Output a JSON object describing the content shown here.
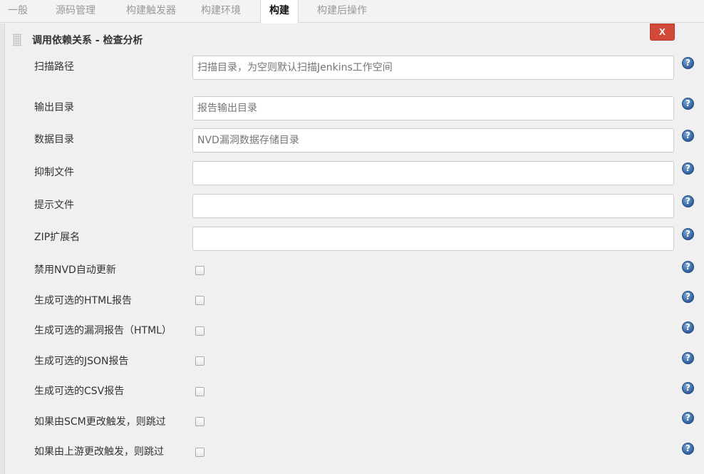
{
  "tabs": [
    {
      "label": "一般"
    },
    {
      "label": "源码管理"
    },
    {
      "label": "构建触发器"
    },
    {
      "label": "构建环境"
    },
    {
      "label": "构建"
    },
    {
      "label": "构建后操作"
    }
  ],
  "active_tab": "构建",
  "section": {
    "title": "调用依赖关系 - 检查分析",
    "delete_label": "X"
  },
  "fields": {
    "scan_path": {
      "label": "扫描路径",
      "placeholder": "扫描目录，为空则默认扫描Jenkins工作空间",
      "value": ""
    },
    "output_dir": {
      "label": "输出目录",
      "placeholder": "报告输出目录",
      "value": ""
    },
    "data_dir": {
      "label": "数据目录",
      "placeholder": "NVD漏洞数据存储目录",
      "value": ""
    },
    "suppression_file": {
      "label": "抑制文件",
      "placeholder": "",
      "value": ""
    },
    "hint_file": {
      "label": "提示文件",
      "placeholder": "",
      "value": ""
    },
    "zip_extensions": {
      "label": "ZIP扩展名",
      "placeholder": "",
      "value": ""
    }
  },
  "checkboxes": [
    {
      "label": "禁用NVD自动更新",
      "checked": false
    },
    {
      "label": "生成可选的HTML报告",
      "checked": false
    },
    {
      "label": "生成可选的漏洞报告（HTML）",
      "checked": false
    },
    {
      "label": "生成可选的JSON报告",
      "checked": false
    },
    {
      "label": "生成可选的CSV报告",
      "checked": false
    },
    {
      "label": "如果由SCM更改触发，则跳过",
      "checked": false
    },
    {
      "label": "如果由上游更改触发，则跳过",
      "checked": false
    }
  ],
  "help_glyph": "?",
  "icons": {
    "help": "help-icon",
    "grip": "drag-handle-icon",
    "delete": "close-icon"
  },
  "colors": {
    "delete_button": "#d24939",
    "help_icon": "#2f5f9e",
    "background": "#f0f0f0"
  }
}
